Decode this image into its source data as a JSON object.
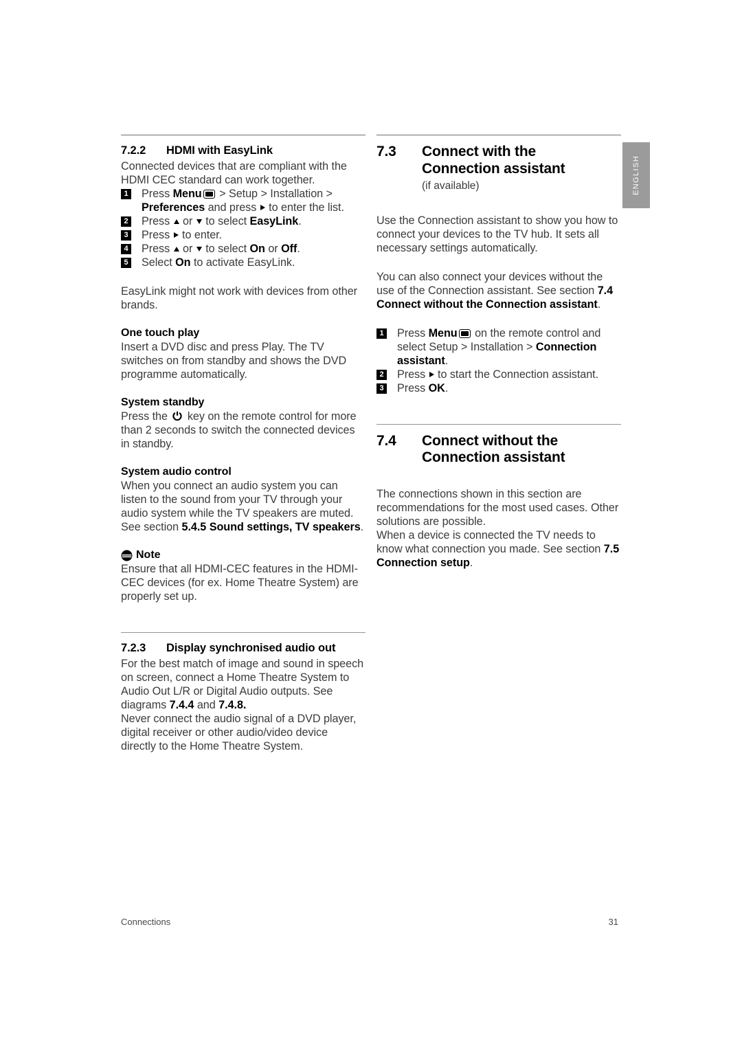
{
  "page": {
    "side_tab_label": "ENGLISH",
    "side_tab_color": "#9b9b9b",
    "footer_left": "Connections",
    "footer_page_number": "31",
    "text_color": "#3b3b3d",
    "heading_color": "#000000"
  },
  "left_column": {
    "section_722": {
      "number": "7.2.2",
      "title": "HDMI with EasyLink",
      "intro": "Connected devices that are compliant with the HDMI CEC standard can work together.",
      "steps": [
        {
          "n": "1",
          "parts": [
            {
              "t": "Press "
            },
            {
              "t": "Menu",
              "b": true
            },
            {
              "icon": "menu-icon"
            },
            {
              "t": " > Setup > Installation > "
            },
            {
              "t": "Preferences",
              "b": true
            },
            {
              "t": " and press "
            },
            {
              "icon": "arrow-right-icon"
            },
            {
              "t": " to enter the list."
            }
          ]
        },
        {
          "n": "2",
          "parts": [
            {
              "t": "Press "
            },
            {
              "icon": "arrow-up-icon"
            },
            {
              "t": " or "
            },
            {
              "icon": "arrow-down-icon"
            },
            {
              "t": " to select "
            },
            {
              "t": "EasyLink",
              "b": true
            },
            {
              "t": "."
            }
          ]
        },
        {
          "n": "3",
          "parts": [
            {
              "t": "Press "
            },
            {
              "icon": "arrow-right-icon"
            },
            {
              "t": " to enter."
            }
          ]
        },
        {
          "n": "4",
          "parts": [
            {
              "t": "Press "
            },
            {
              "icon": "arrow-up-icon"
            },
            {
              "t": " or "
            },
            {
              "icon": "arrow-down-icon"
            },
            {
              "t": " to select "
            },
            {
              "t": "On",
              "b": true
            },
            {
              "t": " or "
            },
            {
              "t": "Off",
              "b": true
            },
            {
              "t": "."
            }
          ]
        },
        {
          "n": "5",
          "parts": [
            {
              "t": "Select "
            },
            {
              "t": "On",
              "b": true
            },
            {
              "t": " to activate EasyLink."
            }
          ]
        }
      ],
      "after_steps": "EasyLink might not work with devices from other brands."
    },
    "one_touch_play": {
      "heading": "One touch play",
      "body": "Insert a DVD disc and press Play. The TV switches on from standby and shows the DVD programme automatically."
    },
    "system_standby": {
      "heading": "System standby",
      "body_before_icon": "Press the ",
      "icon": "power-icon",
      "body_after_icon": " key on the remote control for more than 2 seconds to switch the connected devices in standby."
    },
    "system_audio_control": {
      "heading": "System audio control",
      "body_plain": "When you connect an audio system you can listen to the sound from your TV through your audio system while the TV speakers are muted. See section ",
      "bold_ref": "5.4.5 Sound settings, TV speakers",
      "body_end": "."
    },
    "note": {
      "icon": "note-icon",
      "label": "Note",
      "body": "Ensure that all HDMI-CEC features in the HDMI-CEC devices (for ex. Home Theatre System) are properly set up."
    },
    "section_723": {
      "number": "7.2.3",
      "title": "Display synchronised audio out",
      "para1_a": "For the best match of image and sound in speech on screen, connect a Home Theatre System to Audio Out L/R or Digital Audio outputs. See diagrams ",
      "para1_ref1": "7.4.4",
      "para1_b": " and ",
      "para1_ref2": "7.4.8.",
      "para2": "Never connect the audio signal of a DVD player, digital receiver or other audio/video device directly to the Home Theatre System."
    }
  },
  "right_column": {
    "section_73": {
      "number": "7.3",
      "title_line1": "Connect with the",
      "title_line2": "Connection assistant",
      "subtitle": "(if available)",
      "para1": "Use the Connection assistant to show you how to connect your devices to the TV hub. It sets all necessary settings automatically.",
      "para2_a": "You can also connect your devices without the use of the Connection assistant. See section ",
      "para2_ref": "7.4",
      "para2_b": "Connect without the Connection assistant",
      "para2_end": ".",
      "steps": [
        {
          "n": "1",
          "parts": [
            {
              "t": "Press "
            },
            {
              "t": "Menu",
              "b": true
            },
            {
              "icon": "menu-icon"
            },
            {
              "t": " on the remote control and select Setup > Installation > "
            },
            {
              "t": "Connection assistant",
              "b": true
            },
            {
              "t": "."
            }
          ]
        },
        {
          "n": "2",
          "parts": [
            {
              "t": "Press "
            },
            {
              "icon": "arrow-right-icon"
            },
            {
              "t": " to start the Connection assistant."
            }
          ]
        },
        {
          "n": "3",
          "parts": [
            {
              "t": "Press "
            },
            {
              "t": "OK",
              "b": true
            },
            {
              "t": "."
            }
          ]
        }
      ]
    },
    "section_74": {
      "number": "7.4",
      "title_line1": "Connect without the",
      "title_line2": "Connection assistant",
      "para_a": "The connections shown in this section are recommendations for the most used cases. Other solutions are possible.",
      "para_b": "When a device is connected the TV needs to know what connection you made. See section ",
      "para_ref": "7.5",
      "para_c": "Connection setup",
      "para_end": "."
    }
  }
}
